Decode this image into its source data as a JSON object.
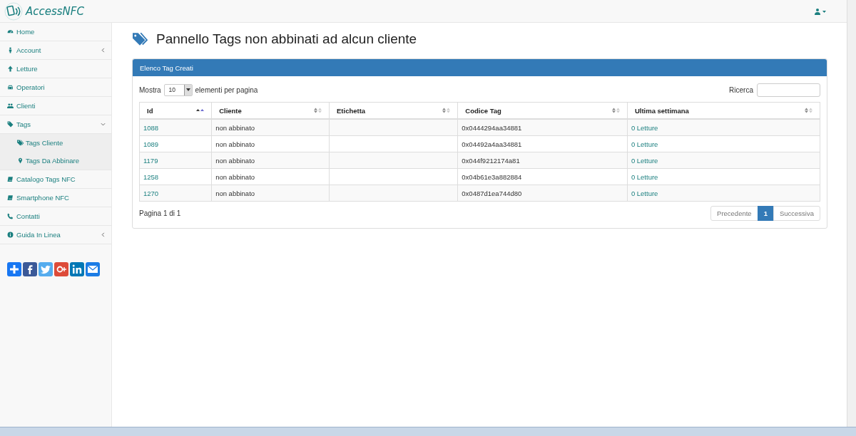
{
  "navbar": {
    "brand": "AccessNFC"
  },
  "sidebar": {
    "items": [
      {
        "label": "Home",
        "kind": "dashboard"
      },
      {
        "label": "Account",
        "kind": "person",
        "expanded": false
      },
      {
        "label": "Letture",
        "kind": "arrow"
      },
      {
        "label": "Operatori",
        "kind": "car"
      },
      {
        "label": "Clienti",
        "kind": "users"
      },
      {
        "label": "Tags",
        "kind": "tag",
        "expanded": true,
        "children": [
          {
            "label": "Tags Cliente",
            "kind": "tags"
          },
          {
            "label": "Tags Da Abbinare",
            "kind": "pin"
          }
        ]
      },
      {
        "label": "Catalogo Tags NFC",
        "kind": "book"
      },
      {
        "label": "Smartphone NFC",
        "kind": "book"
      },
      {
        "label": "Contatti",
        "kind": "phone"
      },
      {
        "label": "Guida In Linea",
        "kind": "info",
        "expanded": false
      }
    ],
    "share": [
      {
        "kind": "plus",
        "color": "#1877f2"
      },
      {
        "kind": "facebook",
        "color": "#3b5998"
      },
      {
        "kind": "twitter",
        "color": "#55acee"
      },
      {
        "kind": "google",
        "color": "#dd4b39"
      },
      {
        "kind": "linkedin",
        "color": "#0077b5"
      },
      {
        "kind": "mail",
        "color": "#1c7ce5"
      }
    ]
  },
  "page": {
    "title": "Pannello Tags non abbinati ad alcun cliente"
  },
  "panel": {
    "heading": "Elenco Tag Creati",
    "length": {
      "before": "Mostra",
      "value": "10",
      "after": "elementi per pagina"
    },
    "search": {
      "label": "Ricerca"
    },
    "table": {
      "columns": [
        {
          "label": "Id",
          "sorted": true
        },
        {
          "label": "Cliente",
          "sorted": false
        },
        {
          "label": "Etichetta",
          "sorted": false
        },
        {
          "label": "Codice Tag",
          "sorted": false
        },
        {
          "label": "Ultima settimana",
          "sorted": false
        }
      ],
      "rows": [
        {
          "id": "1088",
          "cliente": "non abbinato",
          "codice": "0x0444294aa34881",
          "letture": "0 Letture"
        },
        {
          "id": "1089",
          "cliente": "non abbinato",
          "codice": "0x04492a4aa34881",
          "letture": "0 Letture"
        },
        {
          "id": "1179",
          "cliente": "non abbinato",
          "codice": "0x044f9212174a81",
          "letture": "0 Letture"
        },
        {
          "id": "1258",
          "cliente": "non abbinato",
          "codice": "0x04b61e3a882884",
          "letture": "0 Letture"
        },
        {
          "id": "1270",
          "cliente": "non abbinato",
          "codice": "0x0487d1ea744d80",
          "letture": "0 Letture"
        }
      ]
    },
    "info": "Pagina 1 di 1",
    "pagination": [
      {
        "label": "Precedente",
        "selected": false
      },
      {
        "label": "1",
        "selected": true
      },
      {
        "label": "Successiva",
        "selected": false
      }
    ]
  }
}
